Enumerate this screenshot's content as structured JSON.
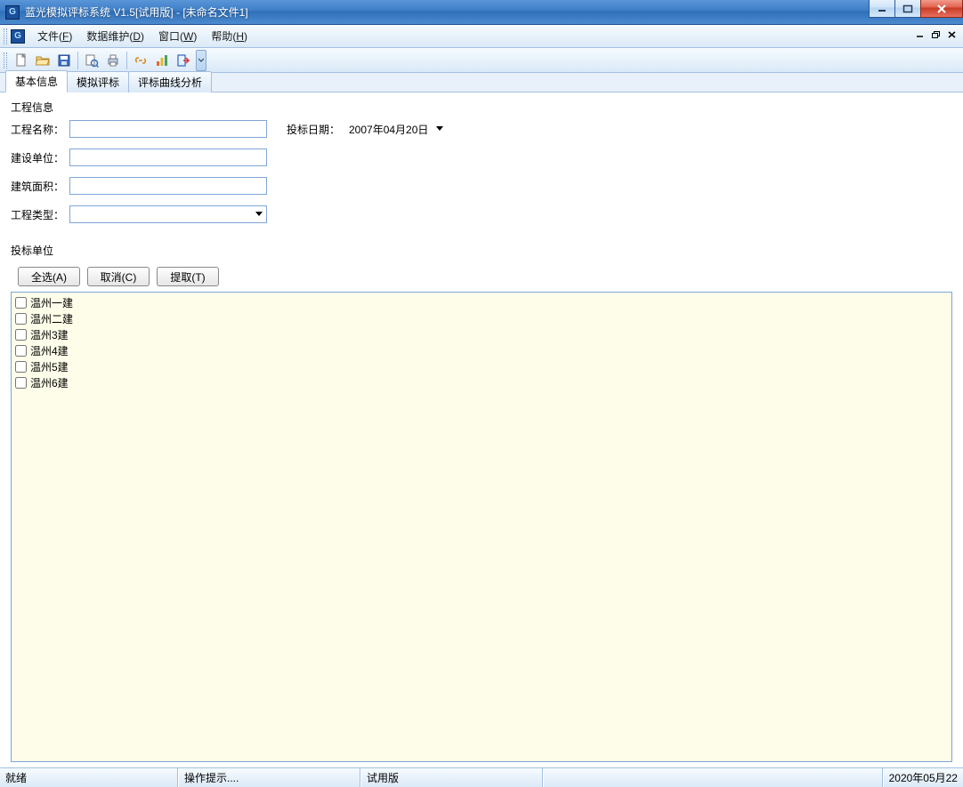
{
  "window": {
    "title": "蓝光模拟评标系统 V1.5[试用版] - [未命名文件1]"
  },
  "menus": {
    "file": {
      "label": "文件(",
      "accel": "F",
      "tail": ")"
    },
    "data": {
      "label": "数据维护(",
      "accel": "D",
      "tail": ")"
    },
    "win": {
      "label": "窗口(",
      "accel": "W",
      "tail": ")"
    },
    "help": {
      "label": "帮助(",
      "accel": "H",
      "tail": ")"
    }
  },
  "tabs": {
    "basic": "基本信息",
    "sim": "模拟评标",
    "curve": "评标曲线分析"
  },
  "form": {
    "group_project": "工程信息",
    "name_label": "工程名称：",
    "name_value": "",
    "unit_label": "建设单位：",
    "unit_value": "",
    "area_label": "建筑面积：",
    "area_value": "",
    "type_label": "工程类型：",
    "type_value": "",
    "date_label": "投标日期：",
    "date_value": "2007年04月20日"
  },
  "bidders": {
    "group": "投标单位",
    "select_all": "全选(A)",
    "cancel": "取消(C)",
    "extract": "提取(T)",
    "items": [
      "温州一建",
      "温州二建",
      "温州3建",
      "温州4建",
      "温州5建",
      "温州6建"
    ]
  },
  "status": {
    "ready": "就绪",
    "hint": "操作提示....",
    "edition": "试用版",
    "date": "2020年05月22"
  },
  "icons": {
    "new": "new-file",
    "open": "open-folder",
    "save": "save",
    "preview": "print-preview",
    "print": "print",
    "tool1": "link",
    "tool2": "chart",
    "exit": "exit"
  }
}
